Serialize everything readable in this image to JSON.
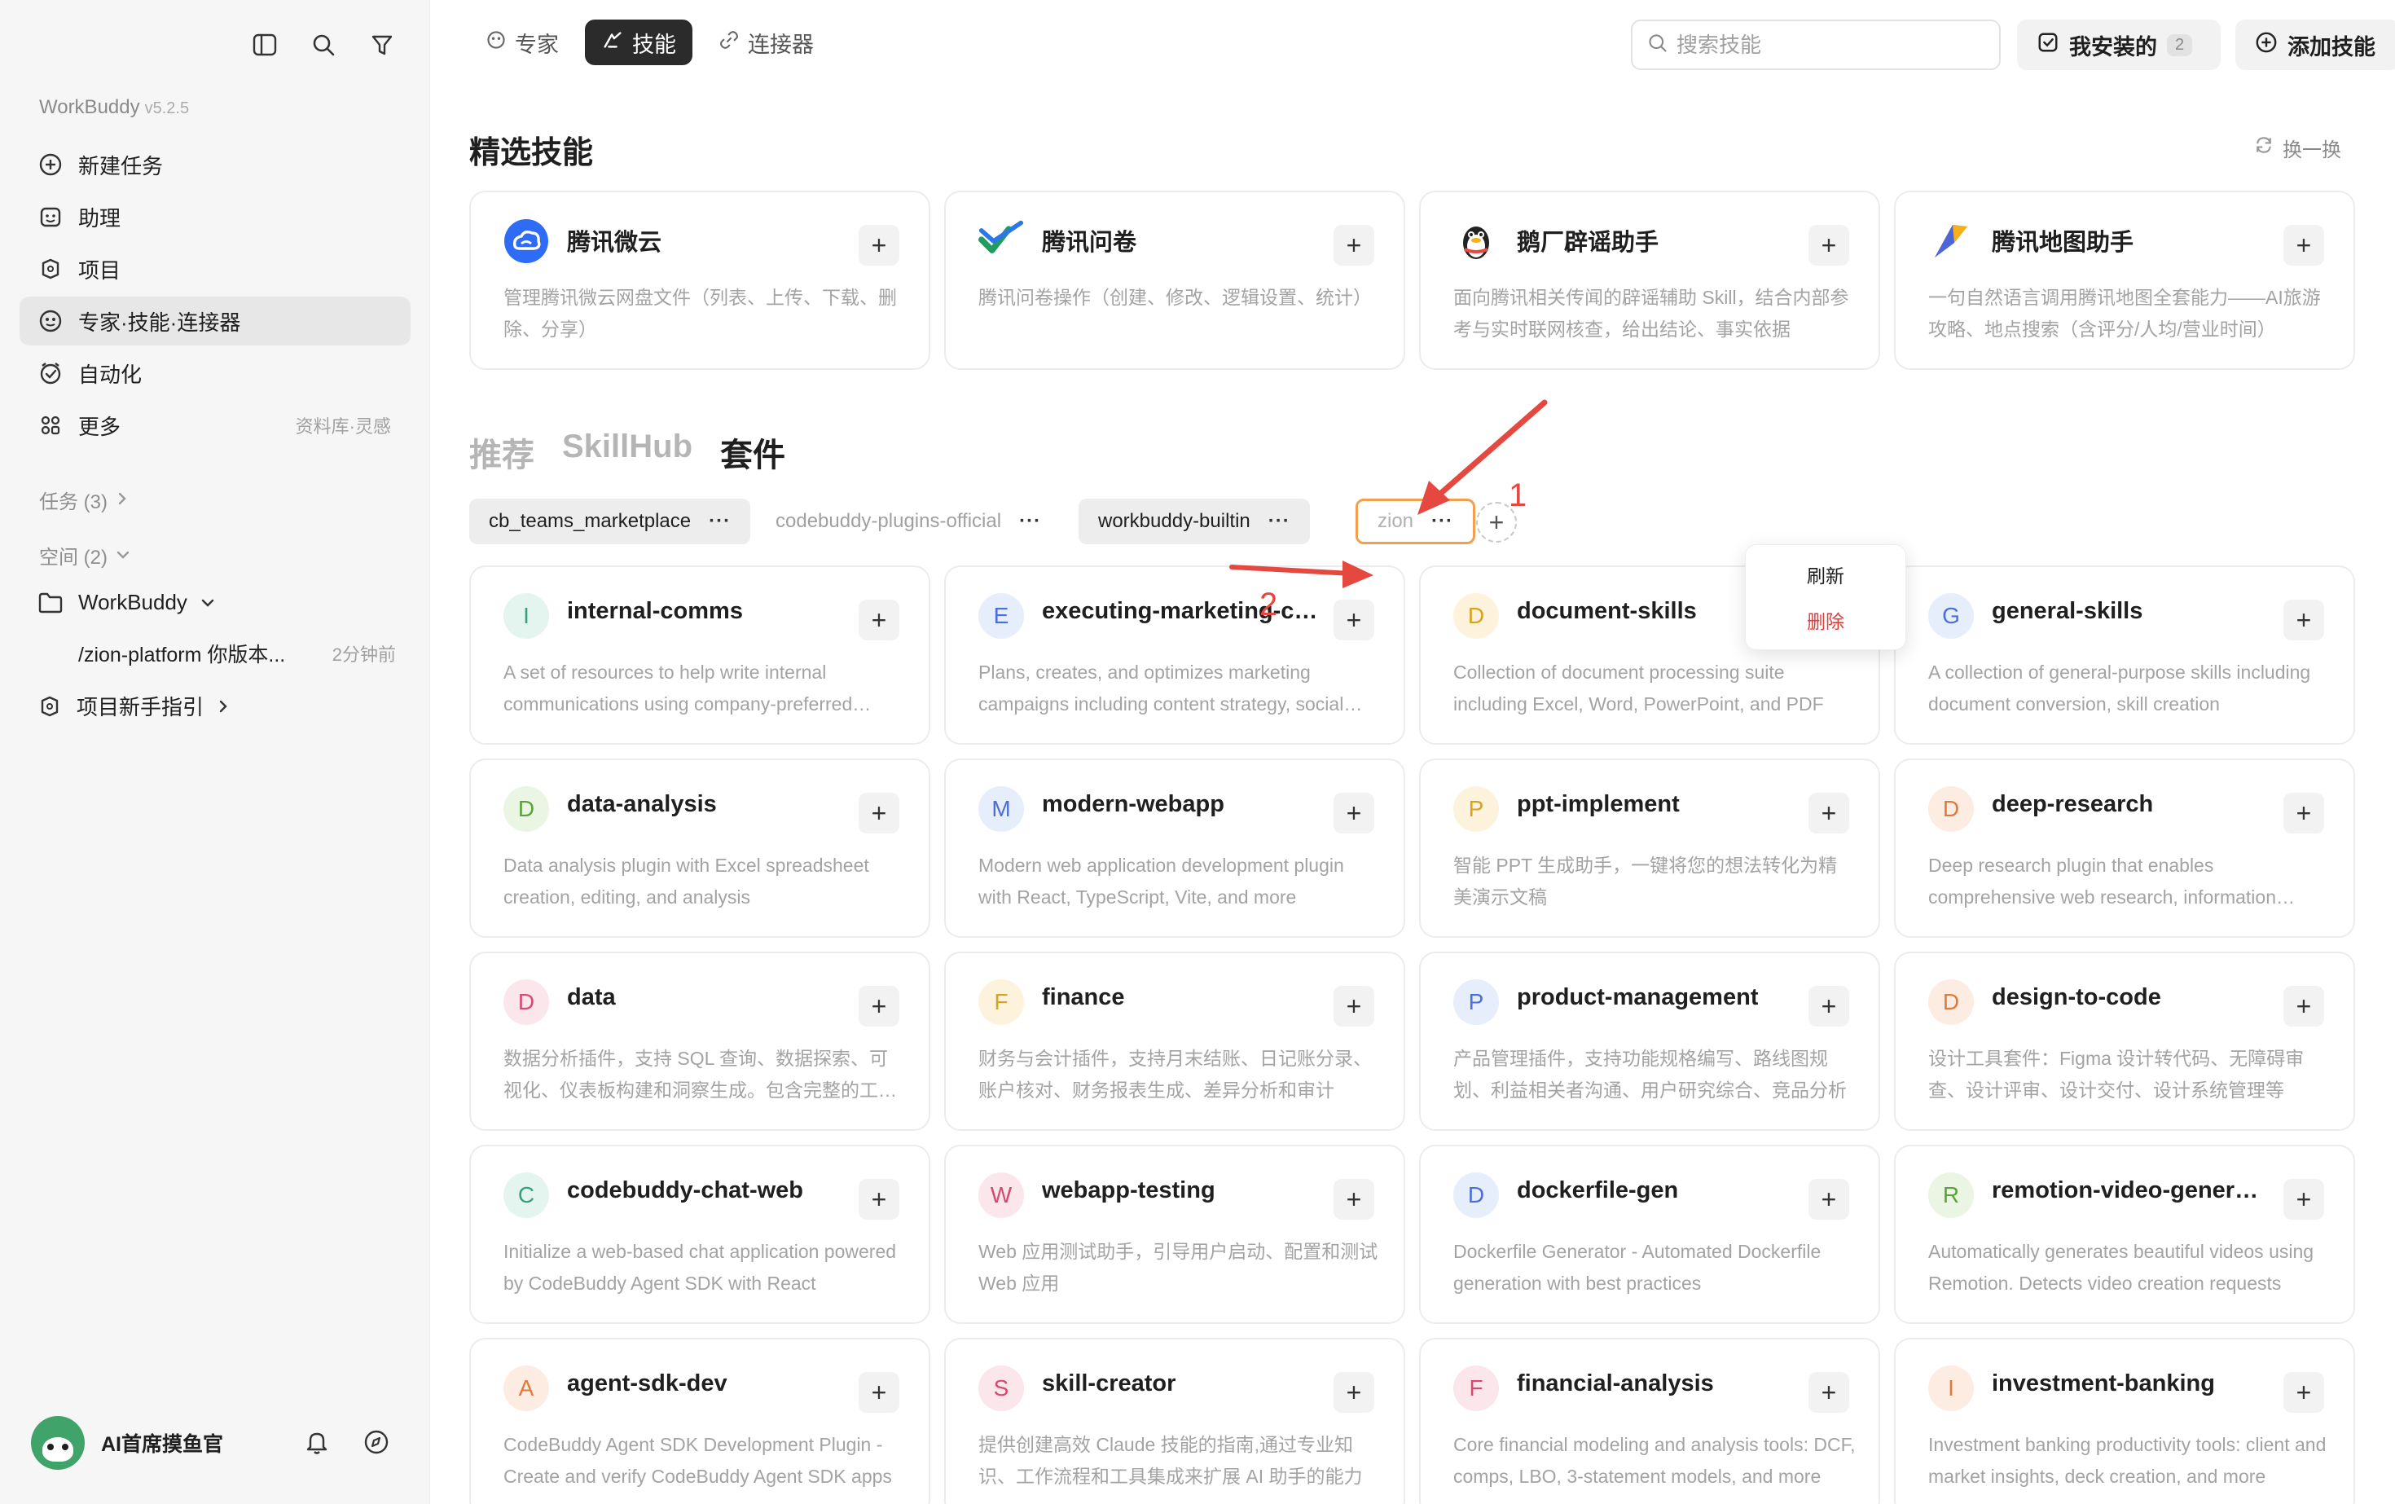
{
  "sidebar": {
    "brand": "WorkBuddy",
    "version": "v5.2.5",
    "nav": [
      {
        "label": "新建任务",
        "icon": "plus-circle-icon"
      },
      {
        "label": "助理",
        "icon": "assistant-icon"
      },
      {
        "label": "项目",
        "icon": "project-icon"
      },
      {
        "label": "专家·技能·连接器",
        "icon": "expert-icon"
      },
      {
        "label": "自动化",
        "icon": "automation-icon"
      },
      {
        "label": "更多",
        "icon": "grid-icon",
        "sub": "资料库·灵感"
      }
    ],
    "tasks_label": "任务 (3)",
    "spaces_label": "空间 (2)",
    "workspace": "WorkBuddy",
    "recent_item": "/zion-platform 你版本...",
    "recent_time": "2分钟前",
    "guide": "项目新手指引",
    "user": "AI首席摸鱼官"
  },
  "topbar": {
    "tabs": [
      "专家",
      "技能",
      "连接器"
    ],
    "search_placeholder": "搜索技能",
    "installed_label": "我安装的",
    "installed_count": "2",
    "add_label": "添加技能"
  },
  "featured": {
    "title": "精选技能",
    "refresh": "换一换",
    "cards": [
      {
        "title": "腾讯微云",
        "desc": "管理腾讯微云网盘文件（列表、上传、下载、删除、分享）",
        "icon_color": "#2f6cf5"
      },
      {
        "title": "腾讯问卷",
        "desc": "腾讯问卷操作（创建、修改、逻辑设置、统计）",
        "icon_color": "#1fb87a"
      },
      {
        "title": "鹅厂辟谣助手",
        "desc": "面向腾讯相关传闻的辟谣辅助 Skill，结合内部参考与实时联网核查，给出结论、事实依据",
        "icon_color": "#222222"
      },
      {
        "title": "腾讯地图助手",
        "desc": "一句自然语言调用腾讯地图全套能力——AI旅游攻略、地点搜索（含评分/人均/营业时间）",
        "icon_color": "#e5483f"
      }
    ]
  },
  "sections": {
    "tabs": [
      "推荐",
      "SkillHub",
      "套件"
    ],
    "active": 2
  },
  "chips": [
    {
      "label": "cb_teams_marketplace",
      "style": "filled"
    },
    {
      "label": "codebuddy-plugins-official",
      "style": "plain"
    },
    {
      "label": "workbuddy-builtin",
      "style": "filled"
    },
    {
      "label": "zion",
      "style": "outlined"
    }
  ],
  "dropdown": {
    "refresh": "刷新",
    "delete": "删除"
  },
  "annotations": {
    "one": "1",
    "two": "2"
  },
  "skills": [
    {
      "letter": "I",
      "title": "internal-comms",
      "desc": "A set of resources to help write internal communications using company-preferred formats",
      "bg": "#e3f5ee",
      "fg": "#35a37a"
    },
    {
      "letter": "E",
      "title": "executing-marketing-campaigns",
      "desc": "Plans, creates, and optimizes marketing campaigns including content strategy, social media",
      "bg": "#e6edfb",
      "fg": "#4a6fd6"
    },
    {
      "letter": "D",
      "title": "document-skills",
      "desc": "Collection of document processing suite including Excel, Word, PowerPoint, and PDF",
      "bg": "#fdf3dc",
      "fg": "#d7a21e"
    },
    {
      "letter": "G",
      "title": "general-skills",
      "desc": "A collection of general-purpose skills including document conversion, skill creation",
      "bg": "#e6edfb",
      "fg": "#4a6fd6"
    },
    {
      "letter": "D",
      "title": "data-analysis",
      "desc": "Data analysis plugin with Excel spreadsheet creation, editing, and analysis",
      "bg": "#eaf6e3",
      "fg": "#5aa33a"
    },
    {
      "letter": "M",
      "title": "modern-webapp",
      "desc": "Modern web application development plugin with React, TypeScript, Vite, and more",
      "bg": "#e6edfb",
      "fg": "#4a6fd6"
    },
    {
      "letter": "P",
      "title": "ppt-implement",
      "desc": "智能 PPT 生成助手，一键将您的想法转化为精美演示文稿",
      "bg": "#fdf3dc",
      "fg": "#d7a21e"
    },
    {
      "letter": "D",
      "title": "deep-research",
      "desc": "Deep research plugin that enables comprehensive web research, information synthesis",
      "bg": "#fdece2",
      "fg": "#e07a3c"
    },
    {
      "letter": "D",
      "title": "data",
      "desc": "数据分析插件，支持 SQL 查询、数据探索、可视化、仪表板构建和洞察生成。包含完整的工作流",
      "bg": "#fbe6ec",
      "fg": "#d64a72"
    },
    {
      "letter": "F",
      "title": "finance",
      "desc": "财务与会计插件，支持月末结账、日记账分录、账户核对、财务报表生成、差异分析和审计",
      "bg": "#fdf3dc",
      "fg": "#d7a21e"
    },
    {
      "letter": "P",
      "title": "product-management",
      "desc": "产品管理插件，支持功能规格编写、路线图规划、利益相关者沟通、用户研究综合、竞品分析",
      "bg": "#e6edfb",
      "fg": "#4a6fd6"
    },
    {
      "letter": "D",
      "title": "design-to-code",
      "desc": "设计工具套件：Figma 设计转代码、无障碍审查、设计评审、设计交付、设计系统管理等",
      "bg": "#fdece2",
      "fg": "#e07a3c"
    },
    {
      "letter": "C",
      "title": "codebuddy-chat-web",
      "desc": "Initialize a web-based chat application powered by CodeBuddy Agent SDK with React",
      "bg": "#e3f5ee",
      "fg": "#35a37a"
    },
    {
      "letter": "W",
      "title": "webapp-testing",
      "desc": "Web 应用测试助手，引导用户启动、配置和测试 Web 应用",
      "bg": "#fbe6ec",
      "fg": "#d64a72"
    },
    {
      "letter": "D",
      "title": "dockerfile-gen",
      "desc": "Dockerfile Generator - Automated Dockerfile generation with best practices",
      "bg": "#e6edfb",
      "fg": "#4a6fd6"
    },
    {
      "letter": "R",
      "title": "remotion-video-generator",
      "desc": "Automatically generates beautiful videos using Remotion. Detects video creation requests",
      "bg": "#eaf6e3",
      "fg": "#5aa33a"
    },
    {
      "letter": "A",
      "title": "agent-sdk-dev",
      "desc": "CodeBuddy Agent SDK Development Plugin - Create and verify CodeBuddy Agent SDK apps",
      "bg": "#fdece2",
      "fg": "#e07a3c"
    },
    {
      "letter": "S",
      "title": "skill-creator",
      "desc": "提供创建高效 Claude 技能的指南,通过专业知识、工作流程和工具集成来扩展 AI 助手的能力",
      "bg": "#fbe6ec",
      "fg": "#d64a72"
    },
    {
      "letter": "F",
      "title": "financial-analysis",
      "desc": "Core financial modeling and analysis tools: DCF, comps, LBO, 3-statement models, and more",
      "bg": "#fbe6ec",
      "fg": "#d64a72"
    },
    {
      "letter": "I",
      "title": "investment-banking",
      "desc": "Investment banking productivity tools: client and market insights, deck creation, and more",
      "bg": "#fdece2",
      "fg": "#e07a3c"
    }
  ]
}
